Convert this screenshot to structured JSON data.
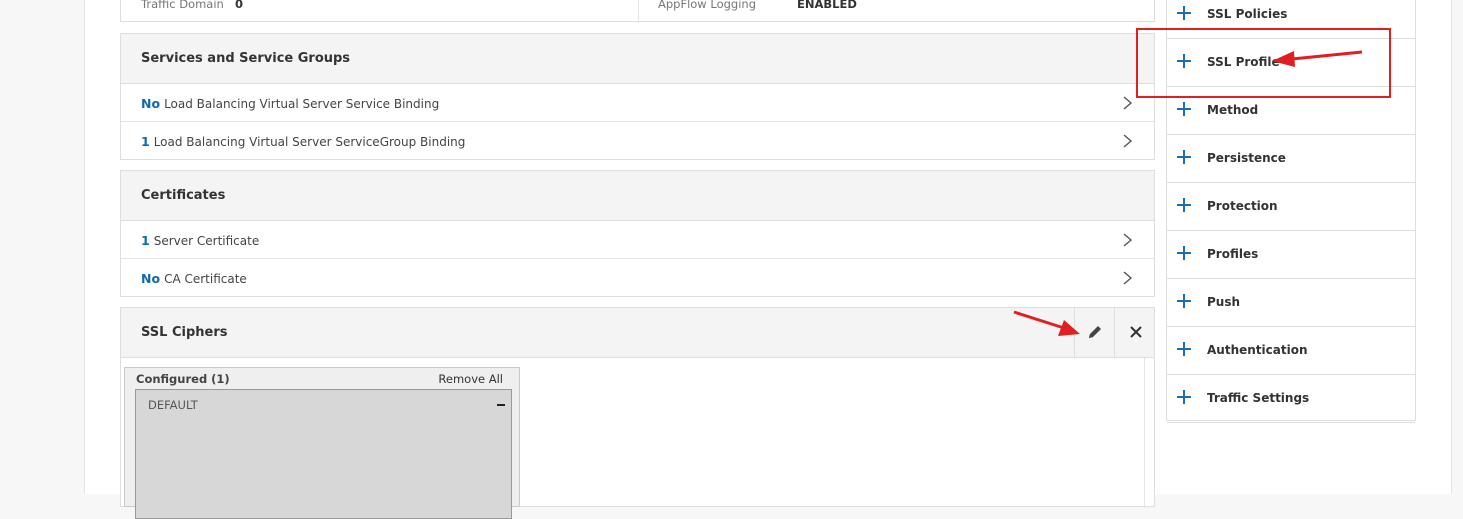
{
  "top_row": {
    "label_left": "Traffic Domain",
    "value_left": "0",
    "label_right": "AppFlow Logging",
    "value_right": "ENABLED"
  },
  "services": {
    "title": "Services and Service Groups",
    "rows": [
      {
        "count": "No",
        "label": "Load Balancing Virtual Server Service Binding"
      },
      {
        "count": "1",
        "label": "Load Balancing Virtual Server ServiceGroup Binding"
      }
    ]
  },
  "certificates": {
    "title": "Certificates",
    "rows": [
      {
        "count": "1",
        "label": "Server Certificate"
      },
      {
        "count": "No",
        "label": "CA Certificate"
      }
    ]
  },
  "ssl_ciphers": {
    "title": "SSL Ciphers",
    "configured_title": "Configured (1)",
    "remove_all": "Remove All",
    "items": [
      "DEFAULT"
    ],
    "edit_icon": "pencil-icon",
    "close_icon": "close-icon"
  },
  "sidebar": {
    "items": [
      {
        "label": "SSL Policies"
      },
      {
        "label": "SSL Profile"
      },
      {
        "label": "Method"
      },
      {
        "label": "Persistence"
      },
      {
        "label": "Protection"
      },
      {
        "label": "Profiles"
      },
      {
        "label": "Push"
      },
      {
        "label": "Authentication"
      },
      {
        "label": "Traffic Settings"
      }
    ]
  },
  "colors": {
    "accent": "#0f6aad",
    "annotation": "#e02020"
  }
}
